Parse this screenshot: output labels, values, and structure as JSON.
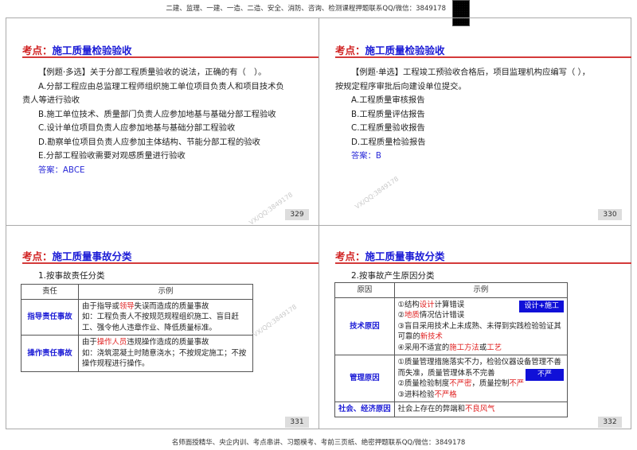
{
  "header_text": "二建、监理、一建、一造、二造、安全、消防、咨询、检测课程押题联系QQ/微信：3849178",
  "footer_text": "名师面授精华、央企内训、考点串讲、习题模考、考前三页纸、绝密押题联系QQ/微信：3849178",
  "watermark": "VX/QQ:3849178",
  "slides": [
    {
      "title_prefix": "考点：",
      "title": "施工质量检验验收",
      "page": "329",
      "question": "【例题·多选】关于分部工程质量验收的说法，正确的有（　）。",
      "options": [
        "A.分部工程应由总监理工程师组织施工单位项目负责人和项目技术负",
        "责人等进行验收",
        "B.施工单位技术、质量部门负责人应参加地基与基础分部工程验收",
        "C.设计单位项目负责人应参加地基与基础分部工程验收",
        "D.勘察单位项目负责人应参加主体结构、节能分部工程的验收",
        "E.分部工程验收需要对观感质量进行验收"
      ],
      "answer": "答案：ABCE"
    },
    {
      "title_prefix": "考点：",
      "title": "施工质量检验验收",
      "page": "330",
      "question": "【例题·单选】工程竣工预验收合格后，项目监理机构应编写（ ），",
      "question_cont": "按规定程序审批后向建设单位提交。",
      "options": [
        "A.工程质量审核报告",
        "B.工程质量评估报告",
        "C.工程质量验收报告",
        "D.工程质量检验报告"
      ],
      "answer": "答案：B"
    },
    {
      "title_prefix": "考点：",
      "title": "施工质量事故分类",
      "page": "331",
      "subtitle": "1.按事故责任分类",
      "headers": [
        "责任",
        "示例"
      ],
      "rows": [
        {
          "key": "指导责任事故",
          "l1a": "由于指导或",
          "l1r": "领导",
          "l1b": "失误而造成的质量事故",
          "l2": "如：工程负责人不按规范规程组织施工、盲目赶工、强令他人违章作业、降低质量标准。"
        },
        {
          "key": "操作责任事故",
          "l1a": "由于",
          "l1r": "操作人员",
          "l1b": "违规操作造成的质量事故",
          "l2": "如：浇筑混凝土时随意浇水；不按规定施工；不按操作规程进行操作。"
        }
      ]
    },
    {
      "title_prefix": "考点：",
      "title": "施工质量事故分类",
      "page": "332",
      "subtitle": "2.按事故产生原因分类",
      "headers": [
        "原因",
        "示例"
      ],
      "tech": {
        "key": "技术原因",
        "tag": "设计+施工",
        "i1a": "①结构",
        "i1r": "设计",
        "i1b": "计算错误",
        "i2r": "地质",
        "i2a": "②",
        "i2b": "情况估计错误",
        "i3a": "③盲目采用技术上未成熟、未得到实践检验验证其可靠的",
        "i3r": "新技术",
        "i4a": "④采用不适宜的",
        "i4r": "施工方法",
        "i4b": "或",
        "i4r2": "工艺"
      },
      "mgmt": {
        "key": "管理原因",
        "tag": "不严",
        "i1": "①质量管理措施落实不力，检验仪器设备管理不善而失准，质量管理体系不完善",
        "i2a": "②质量检验制度",
        "i2r": "不严密",
        "i2b": "，质量控制",
        "i2r2": "不严",
        "i3a": "③进料检验",
        "i3r": "不严格"
      },
      "social": {
        "key": "社会、经济原因",
        "a": "社会上存在的弊端和",
        "r": "不良风气"
      }
    }
  ]
}
